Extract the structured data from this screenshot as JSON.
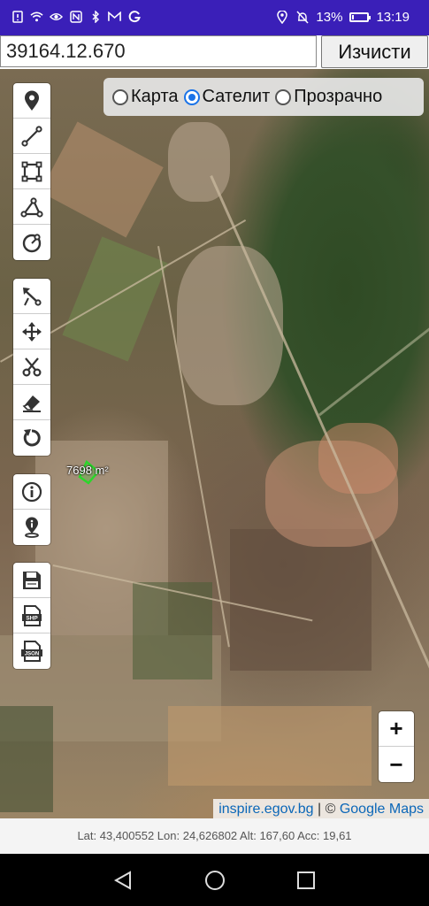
{
  "status_bar": {
    "battery_percent": "13%",
    "time": "13:19",
    "battery_level": 0.13,
    "left_icons": [
      "alert-icon",
      "wifi-icon",
      "eye-icon",
      "nfc-icon",
      "bluetooth-icon",
      "gmail-icon",
      "google-icon"
    ],
    "right_icons": [
      "location-icon",
      "bell-muted-icon"
    ]
  },
  "top_bar": {
    "search_value": "39164.12.670",
    "clear_label": "Изчисти"
  },
  "layer_switch": {
    "options": [
      {
        "label": "Карта",
        "selected": false
      },
      {
        "label": "Сателит",
        "selected": true
      },
      {
        "label": "Прозрачно",
        "selected": false
      }
    ]
  },
  "toolbar": {
    "groups": [
      [
        "marker-icon",
        "line-icon",
        "polygon-icon",
        "angle-measure-icon",
        "circle-icon"
      ],
      [
        "select-edit-icon",
        "move-icon",
        "cut-icon",
        "eraser-icon",
        "undo-icon"
      ],
      [
        "info-icon",
        "location-info-icon"
      ],
      [
        "save-icon",
        "export-shp-icon",
        "export-json-icon"
      ]
    ],
    "shp_text": "SHP",
    "json_text": "JSON"
  },
  "map": {
    "area_label": "7698 m²",
    "polygon_color": "#2bd62b"
  },
  "zoom": {
    "in_label": "+",
    "out_label": "−"
  },
  "attribution": {
    "source_link": "inspire.egov.bg",
    "separator": " | © ",
    "maps_link": "Google Maps"
  },
  "coords": {
    "text": "Lat: 43,400552 Lon: 24,626802 Alt: 167,60 Acc: 19,61"
  },
  "colors": {
    "status_bar_bg": "#3a1fb8",
    "accent": "#1a73e8",
    "link": "#0b67b8"
  }
}
